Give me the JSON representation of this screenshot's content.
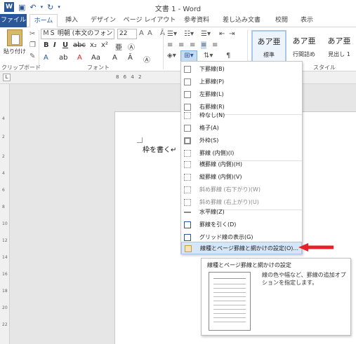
{
  "window": {
    "title": "文書 1 - Word"
  },
  "tabs": [
    {
      "label": "ファイル"
    },
    {
      "label": "ホーム"
    },
    {
      "label": "挿入"
    },
    {
      "label": "デザイン"
    },
    {
      "label": "ページ レイアウト"
    },
    {
      "label": "参考資料"
    },
    {
      "label": "差し込み文書"
    },
    {
      "label": "校閲"
    },
    {
      "label": "表示"
    }
  ],
  "ribbon": {
    "paste_label": "貼り付け",
    "clipboard_label": "クリップボード",
    "font_label": "フォント",
    "style_label": "スタイル",
    "font_name": "ＭＳ 明朝 (本文のフォント",
    "font_size": "22",
    "styles": [
      {
        "sample": "あア亜",
        "name": "標準"
      },
      {
        "sample": "あア亜",
        "name": "行間詰め"
      },
      {
        "sample": "あア亜",
        "name": "見出し 1"
      }
    ]
  },
  "ruler": {
    "numbers": "8 6 4 2"
  },
  "document": {
    "text": "枠を書く↵"
  },
  "border_menu": {
    "items": [
      {
        "label": "下罫線(B)",
        "disabled": false
      },
      {
        "label": "上罫線(P)",
        "disabled": false
      },
      {
        "label": "左罫線(L)",
        "disabled": false
      },
      {
        "label": "右罫線(R)",
        "disabled": false
      },
      {
        "label": "枠なし(N)",
        "disabled": false
      },
      {
        "label": "格子(A)",
        "disabled": false
      },
      {
        "label": "外枠(S)",
        "disabled": false
      },
      {
        "label": "罫線 (内側)(I)",
        "disabled": false
      },
      {
        "label": "横罫線 (内側)(H)",
        "disabled": false
      },
      {
        "label": "縦罫線 (内側)(V)",
        "disabled": false
      },
      {
        "label": "斜め罫線 (右下がり)(W)",
        "disabled": true
      },
      {
        "label": "斜め罫線 (右上がり)(U)",
        "disabled": true
      },
      {
        "label": "水平線(Z)",
        "disabled": false
      },
      {
        "label": "罫線を引く(D)",
        "disabled": false
      },
      {
        "label": "グリッド線の表示(G)",
        "disabled": false
      },
      {
        "label": "線種とページ罫線と網かけの設定(O)...",
        "disabled": false,
        "highlighted": true
      }
    ]
  },
  "tooltip": {
    "title": "線種とページ罫線と網かけの設定",
    "description": "線の色や幅など、罫線の追加オプションを指定します。"
  },
  "colors": {
    "accent": "#2b579a",
    "arrow": "#e8202a",
    "highlight": "#d5e6f7"
  }
}
